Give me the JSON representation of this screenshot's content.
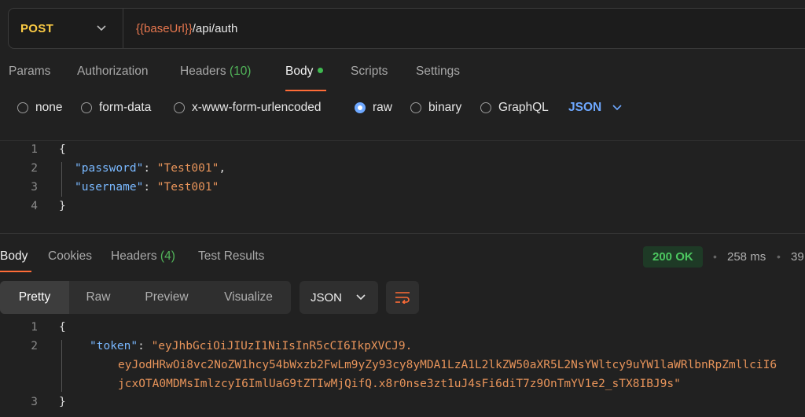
{
  "request": {
    "method": "POST",
    "url_variable": "{{baseUrl}}",
    "url_path": "/api/auth"
  },
  "request_tabs": [
    {
      "label": "Params"
    },
    {
      "label": "Authorization"
    },
    {
      "label": "Headers",
      "count": "(10)"
    },
    {
      "label": "Body"
    },
    {
      "label": "Scripts"
    },
    {
      "label": "Settings"
    }
  ],
  "body_types": [
    "none",
    "form-data",
    "x-www-form-urlencoded",
    "raw",
    "binary",
    "GraphQL"
  ],
  "body_language": "JSON",
  "request_body": {
    "line_numbers": [
      "1",
      "2",
      "3",
      "4"
    ],
    "open_brace": "{",
    "close_brace": "}",
    "password_key": "\"password\"",
    "password_value": "\"Test001\"",
    "username_key": "\"username\"",
    "username_value": "\"Test001\""
  },
  "response_tabs": [
    {
      "label": "Body"
    },
    {
      "label": "Cookies"
    },
    {
      "label": "Headers",
      "count": "(4)"
    },
    {
      "label": "Test Results"
    }
  ],
  "response_meta": {
    "status": "200 OK",
    "time": "258 ms",
    "size": "39"
  },
  "format_tabs": [
    "Pretty",
    "Raw",
    "Preview",
    "Visualize"
  ],
  "format_select": "JSON",
  "response_body": {
    "line_numbers": [
      "1",
      "2",
      "3"
    ],
    "open_brace": "{",
    "close_brace": "}",
    "token_key": "\"token\"",
    "token_line1": "\"eyJhbGciOiJIUzI1NiIsInR5cCI6IkpXVCJ9.",
    "token_line2": "eyJodHRwOi8vc2NoZW1hcy54bWxzb2FwLm9yZy93cy8yMDA1LzA1L2lkZW50aXR5L2NsYWltcy9uYW1laWRlbnRpZmllciI6",
    "token_line3": "jcxOTA0MDMsImlzcyI6ImlUaG9tZTIwMjQifQ.x8r0nse3zt1uJ4sFi6diT7z9OnTmYV1e2_sTX8IBJ9s\""
  },
  "colors": {
    "method": "#fbcb44",
    "variable": "#e8774e",
    "accent": "#ff6c37",
    "status_ok": "#4cc760",
    "json_key": "#79b8ff",
    "json_string": "#e8945a",
    "link_blue": "#6ea8ff"
  },
  "icons": [
    "chevron-down-icon",
    "radio-icon",
    "wrap-lines-icon"
  ]
}
